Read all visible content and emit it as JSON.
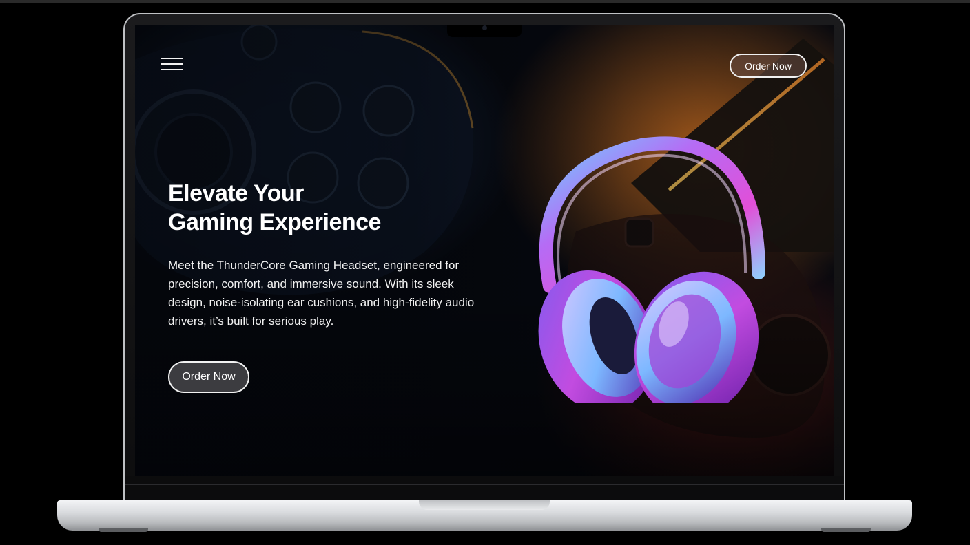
{
  "header": {
    "order_label": "Order Now"
  },
  "hero": {
    "title_line1": "Elevate Your",
    "title_line2": "Gaming Experience",
    "description": "Meet the ThunderCore Gaming Headset, engineered for precision, comfort, and immersive sound. With its sleek design, noise-isolating ear cushions, and high-fidelity audio drivers, it’s built for serious play.",
    "order_label": "Order Now"
  },
  "icons": {
    "menu": "hamburger-menu-icon",
    "product": "headphones-image"
  },
  "colors": {
    "background": "#05070c",
    "accent_purple": "#a43be0",
    "accent_blue": "#3fa8ff",
    "accent_orange": "#e08a2c"
  }
}
